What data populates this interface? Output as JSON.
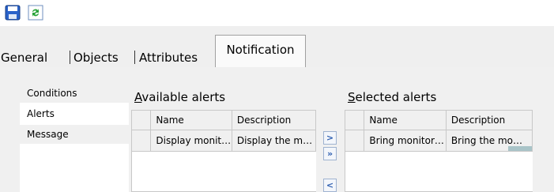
{
  "toolbar": {
    "save_icon": "save-icon",
    "refresh_icon": "refresh-icon"
  },
  "tabs": [
    {
      "label": "General"
    },
    {
      "label": "Objects"
    },
    {
      "label": "Attributes"
    },
    {
      "label": "Notification",
      "active": true
    }
  ],
  "left_list": {
    "items": [
      {
        "label": "Conditions"
      },
      {
        "label": "Alerts",
        "selected": true
      },
      {
        "label": "Message"
      }
    ]
  },
  "available": {
    "title_first": "A",
    "title_rest": "vailable alerts",
    "columns": [
      "Name",
      "Description"
    ],
    "rows": [
      {
        "name": "Display monit…",
        "description": "Display the m…"
      }
    ]
  },
  "selected": {
    "title_first": "S",
    "title_rest": "elected alerts",
    "columns": [
      "Name",
      "Description"
    ],
    "rows": [
      {
        "name": "Bring monitor…",
        "description": "Bring the mo…"
      }
    ]
  },
  "buttons": {
    "add": ">",
    "add_all": "»",
    "remove": "<"
  },
  "colors": {
    "accent": "#2f5fb0",
    "panel_bg": "#f0f0f0"
  }
}
